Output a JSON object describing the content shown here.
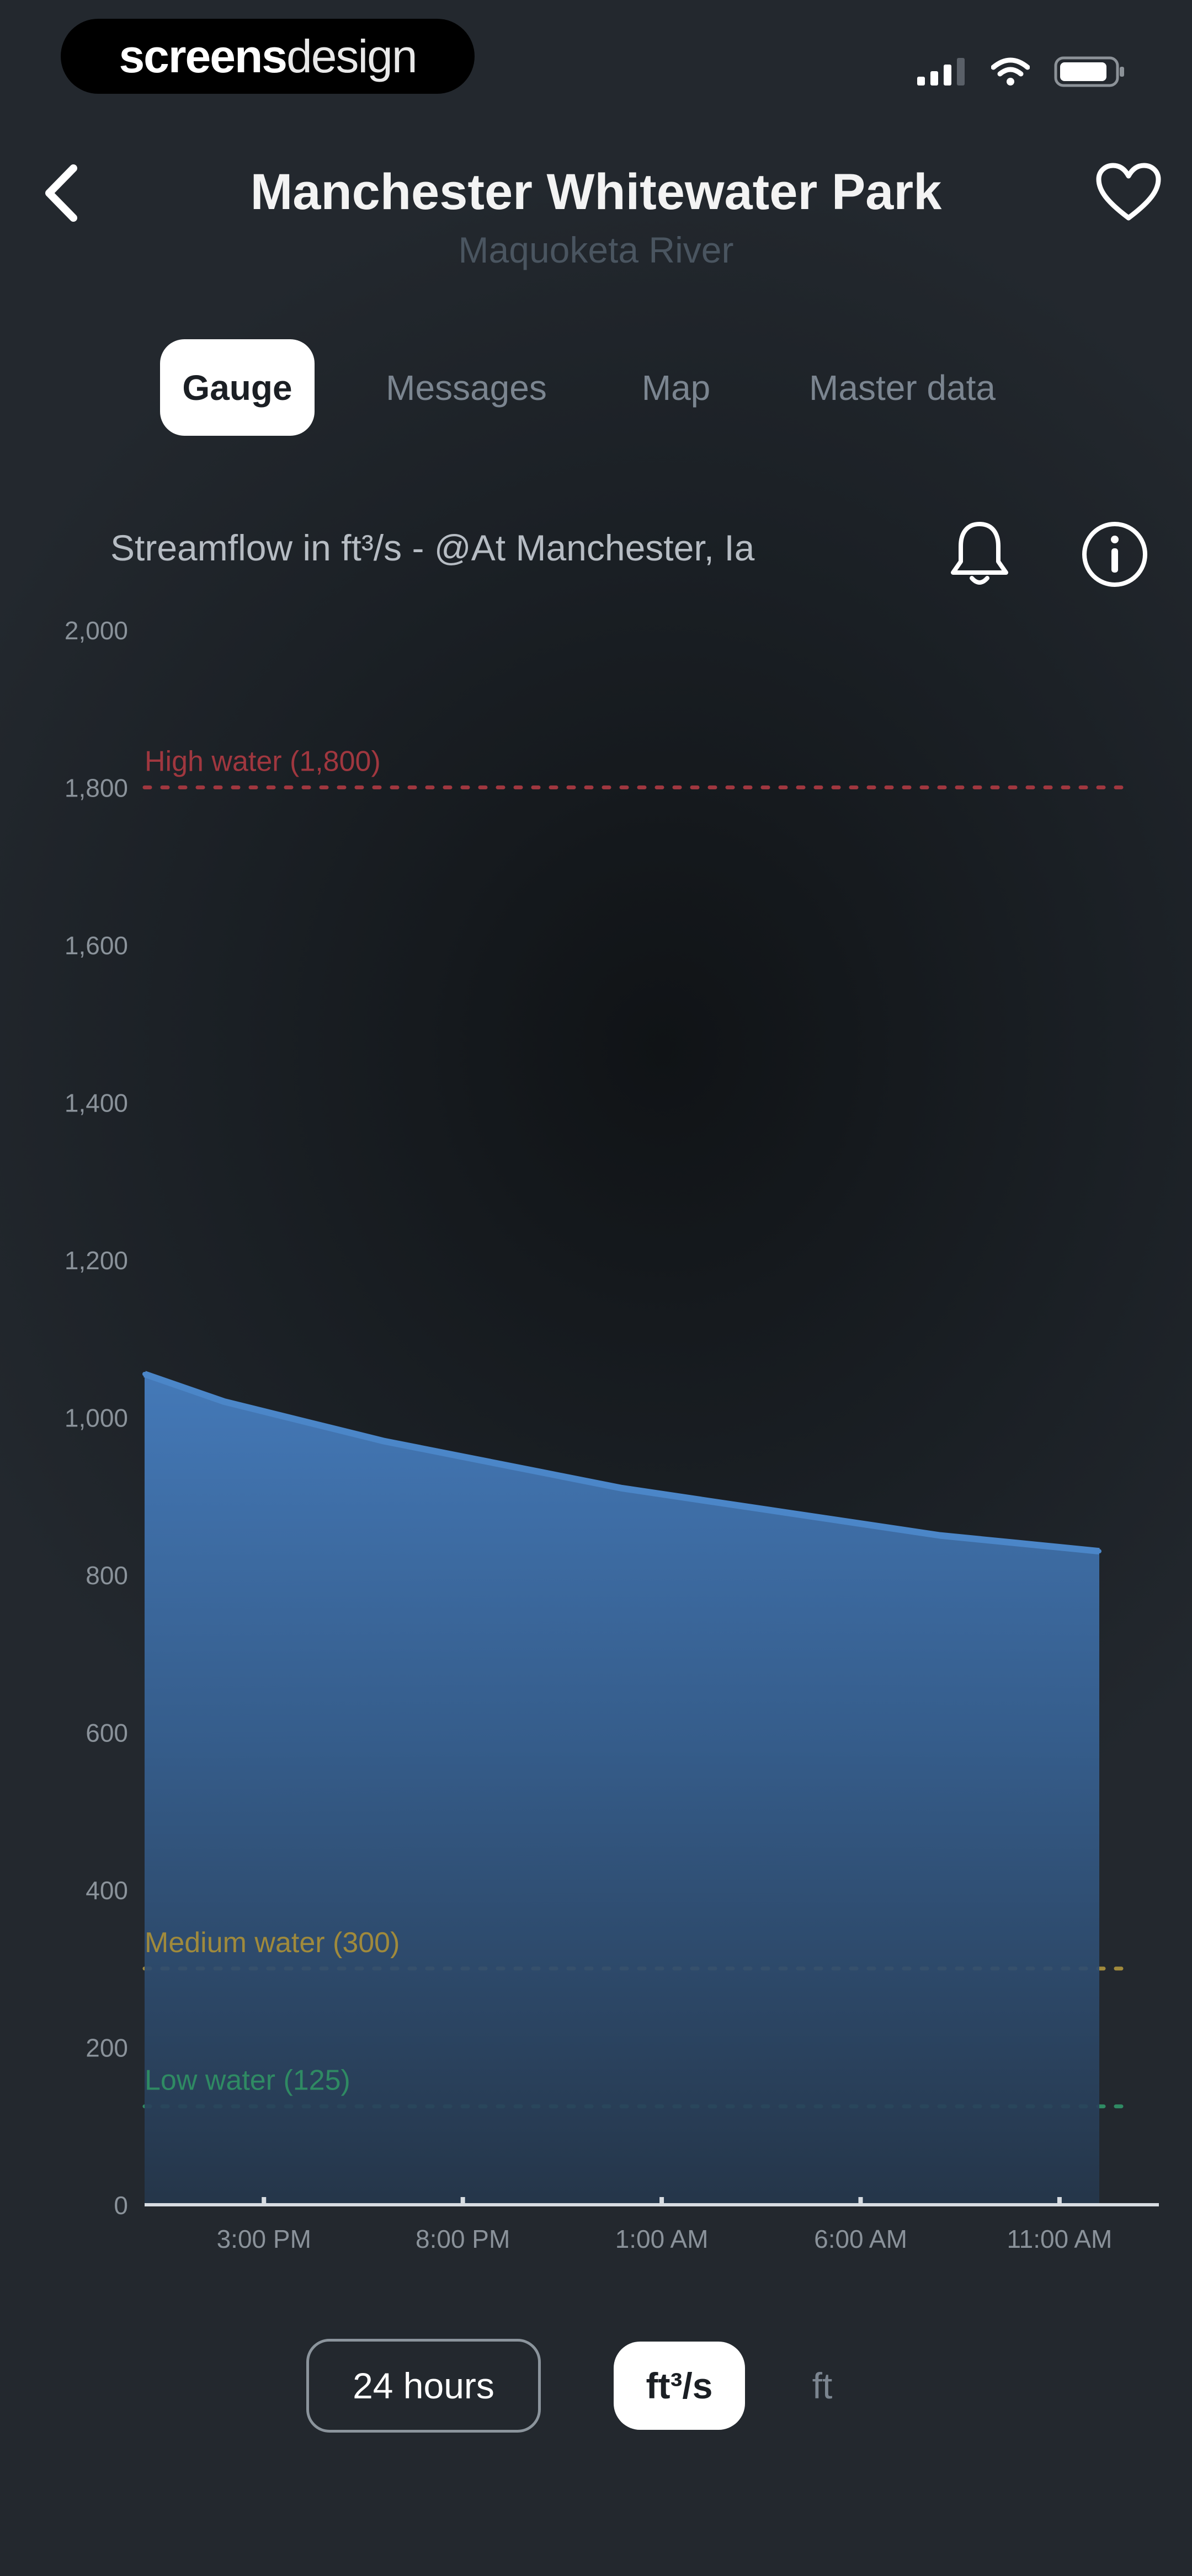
{
  "status_bar": {
    "brand_bold": "screens",
    "brand_light": "design",
    "icons": [
      "signal-icon",
      "wifi-icon",
      "battery-icon"
    ]
  },
  "nav": {
    "title": "Manchester Whitewater Park",
    "subtitle": "Maquoketa River",
    "back_icon": "chevron-left-icon",
    "favorite_icon": "heart-icon"
  },
  "tabs": [
    {
      "label": "Gauge",
      "active": true
    },
    {
      "label": "Messages",
      "active": false
    },
    {
      "label": "Map",
      "active": false
    },
    {
      "label": "Master data",
      "active": false
    }
  ],
  "chart_header": {
    "title": "Streamflow in ft³/s - @At Manchester, Ia",
    "bell_icon": "bell-icon",
    "info_icon": "info-icon"
  },
  "chart_data": {
    "type": "area",
    "title": "Streamflow in ft³/s - @At Manchester, Ia",
    "ylim": [
      0,
      2000
    ],
    "y_ticks": [
      "0",
      "200",
      "400",
      "600",
      "800",
      "1,000",
      "1,200",
      "1,400",
      "1,600",
      "1,800",
      "2,000"
    ],
    "x_ticks": [
      "3:00 PM",
      "8:00 PM",
      "1:00 AM",
      "6:00 AM",
      "11:00 AM"
    ],
    "x_tick_hours": [
      3,
      8,
      13,
      18,
      23
    ],
    "x_range_hours": [
      0,
      24
    ],
    "series": [
      {
        "x_hours": [
          0,
          2,
          4,
          6,
          8,
          10,
          12,
          14,
          16,
          18,
          20,
          22,
          24
        ],
        "values": [
          1055,
          1020,
          995,
          970,
          950,
          930,
          910,
          895,
          880,
          865,
          850,
          840,
          830
        ]
      }
    ],
    "thresholds": [
      {
        "label": "High water (1,800)",
        "value": 1800,
        "color": "#a0373f"
      },
      {
        "label": "Medium water (300)",
        "value": 300,
        "color": "#a08a3c"
      },
      {
        "label": "Low water (125)",
        "value": 125,
        "color": "#2f8a63"
      }
    ],
    "series_color": "#4b86c8",
    "grid": false
  },
  "controls": {
    "range_label": "24 hours",
    "unit_active": "ft³/s",
    "unit_other": "ft"
  }
}
